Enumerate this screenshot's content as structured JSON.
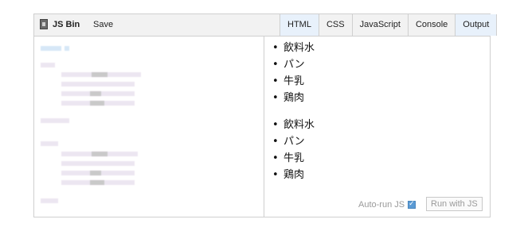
{
  "app": {
    "brand": "JS Bin",
    "save_label": "Save"
  },
  "tabs": [
    {
      "label": "HTML",
      "active": true
    },
    {
      "label": "CSS",
      "active": false
    },
    {
      "label": "JavaScript",
      "active": false
    },
    {
      "label": "Console",
      "active": false
    },
    {
      "label": "Output",
      "active": true
    }
  ],
  "output": {
    "list1": [
      "飲料水",
      "パン",
      "牛乳",
      "鶏肉"
    ],
    "list2": [
      "飲料水",
      "パン",
      "牛乳",
      "鶏肉"
    ]
  },
  "footer": {
    "autorun_label": "Auto-run JS",
    "autorun_checked": true,
    "run_button_label": "Run with JS"
  },
  "colors": {
    "active_tab": "#e8f1fb",
    "checkbox": "#5b9bd5"
  }
}
